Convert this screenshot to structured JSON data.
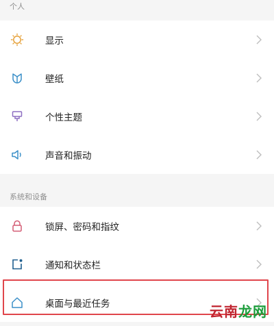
{
  "personal": {
    "title": "个人",
    "items": [
      {
        "label": "显示",
        "icon": "display-sun-icon"
      },
      {
        "label": "壁纸",
        "icon": "wallpaper-tulip-icon"
      },
      {
        "label": "个性主题",
        "icon": "theme-brush-icon"
      },
      {
        "label": "声音和振动",
        "icon": "speaker-icon"
      }
    ]
  },
  "system": {
    "title": "系统和设备",
    "items": [
      {
        "label": "锁屏、密码和指纹",
        "icon": "lock-icon"
      },
      {
        "label": "通知和状态栏",
        "icon": "notification-icon"
      },
      {
        "label": "桌面与最近任务",
        "icon": "home-icon"
      }
    ]
  },
  "watermark": {
    "text1": "云南",
    "text2": "龙网"
  },
  "colors": {
    "accent": "#e6a23c",
    "highlight": "#e0454b",
    "icon": "#3a8fc8"
  }
}
